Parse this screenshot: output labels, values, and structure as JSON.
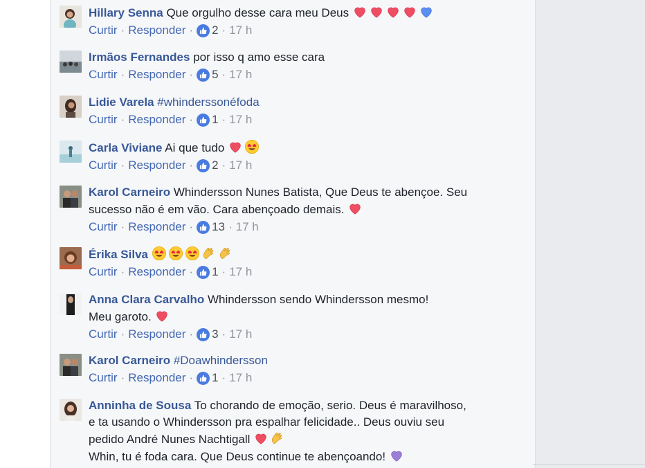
{
  "comments": [
    {
      "author": "Hillary Senna",
      "text": "Que orgulho desse cara meu Deus",
      "emojis": [
        "heart-red",
        "heart-red",
        "heart-red",
        "heart-red",
        "heart-blue"
      ],
      "likes": "2",
      "time": "17 h"
    },
    {
      "author": "Irmãos Fernandes",
      "text": "por isso q amo esse cara",
      "likes": "5",
      "time": "17 h"
    },
    {
      "author": "Lidie Varela",
      "text": "#whinderssonéfoda",
      "likes": "1",
      "time": "17 h"
    },
    {
      "author": "Carla Viviane",
      "text": "Ai que tudo",
      "likes": "2",
      "time": "17 h"
    },
    {
      "author": "Karol Carneiro",
      "text1": "Whindersson Nunes Batista, Que Deus te abençoe. Seu",
      "text2": "sucesso não é em vão. Cara abençoado demais.",
      "likes": "13",
      "time": "17 h"
    },
    {
      "author": "Érika Silva",
      "likes": "1",
      "time": "17 h"
    },
    {
      "author": "Anna Clara Carvalho",
      "text1": "Whindersson sendo Whindersson mesmo!",
      "text2": "Meu garoto.",
      "likes": "3",
      "time": "17 h"
    },
    {
      "author": "Karol Carneiro",
      "text": "#Doawhindersson",
      "likes": "1",
      "time": "17 h"
    },
    {
      "author": "Anninha de Sousa",
      "text1": "To chorando de emoção, serio. Deus é maravilhoso,",
      "text2": "e ta usando o Whindersson pra espalhar felicidade.. Deus ouviu seu",
      "text3": "pedido André Nunes Nachtigall",
      "text4": "Whin, tu é foda cara. Que Deus continue te abençoando!"
    }
  ],
  "actions": {
    "like_label": "Curtir",
    "reply_label": "Responder",
    "separator": "·"
  },
  "colors": {
    "link": "#385898",
    "action_link": "#4267b2",
    "meta": "#90949c",
    "like_blue": "#4a7be0",
    "feed_bg": "#f6f7f9",
    "page_bg": "#e9ebee"
  }
}
